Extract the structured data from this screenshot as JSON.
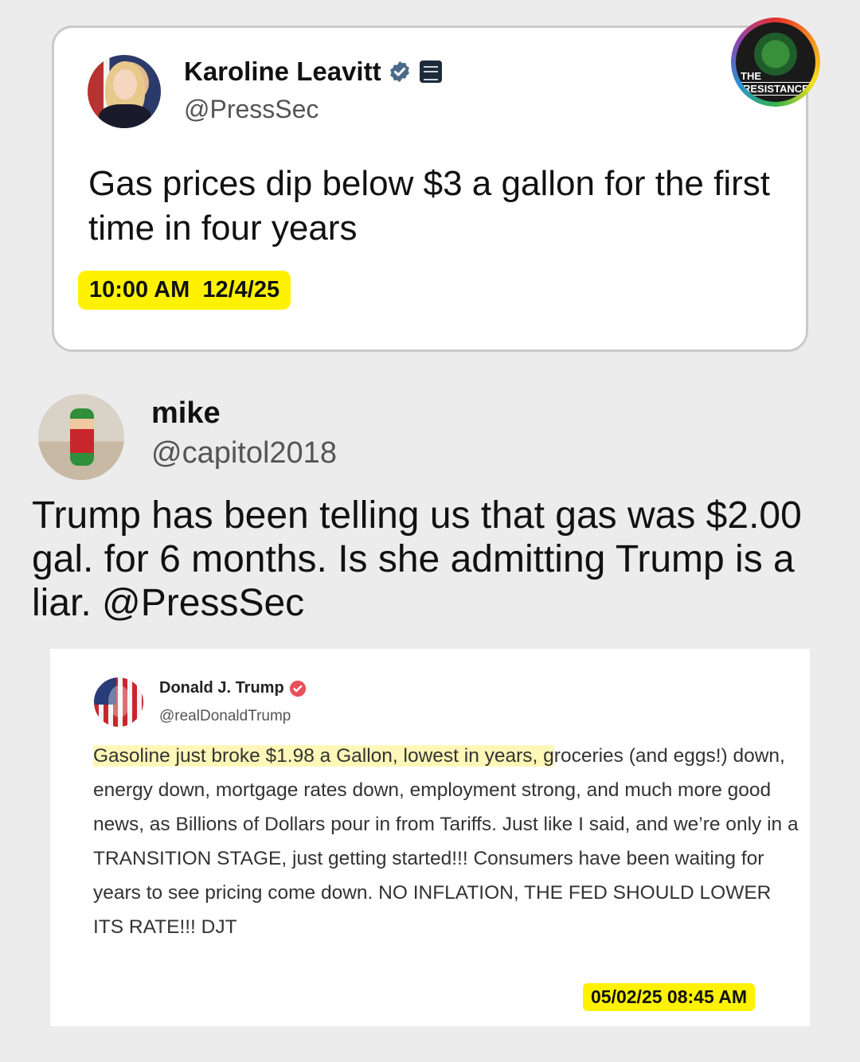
{
  "karoline_post": {
    "name": "Karoline Leavitt",
    "handle": "@PressSec",
    "text": "Gas prices dip below $3 a gallon for the first time in four years",
    "timestamp": "10:00 AM  12/4/25",
    "icons": [
      "verified-badge",
      "white-house-badge"
    ]
  },
  "resistance_badge": {
    "line1": "THE",
    "line2": "RESISTANCE"
  },
  "mike_reply": {
    "name": "mike",
    "handle": "@capitol2018",
    "text": "Trump has been telling us that gas was $2.00 gal. for 6 months. Is she admitting Trump is a liar. @PressSec"
  },
  "trump_post": {
    "name": "Donald J. Trump",
    "handle": "@realDonaldTrump",
    "text_highlighted": "Gasoline just broke $1.98 a Gallon, lowest in years, g",
    "text_rest": "roceries (and eggs!) down, energy down, mortgage rates down, employment strong, and much more good news, as Billions of Dollars pour in from Tariffs. Just like I said, and we’re only in a TRANSITION STAGE, just getting started!!! Consumers have been waiting for years to see pricing come down. NO INFLATION, THE FED SHOULD LOWER ITS RATE!!! DJT",
    "timestamp": "05/02/25 08:45 AM"
  },
  "colors": {
    "highlight": "#fff200",
    "verified_blue": "#1d9bf0",
    "truth_badge": "#e8505b",
    "background": "#ececec"
  }
}
